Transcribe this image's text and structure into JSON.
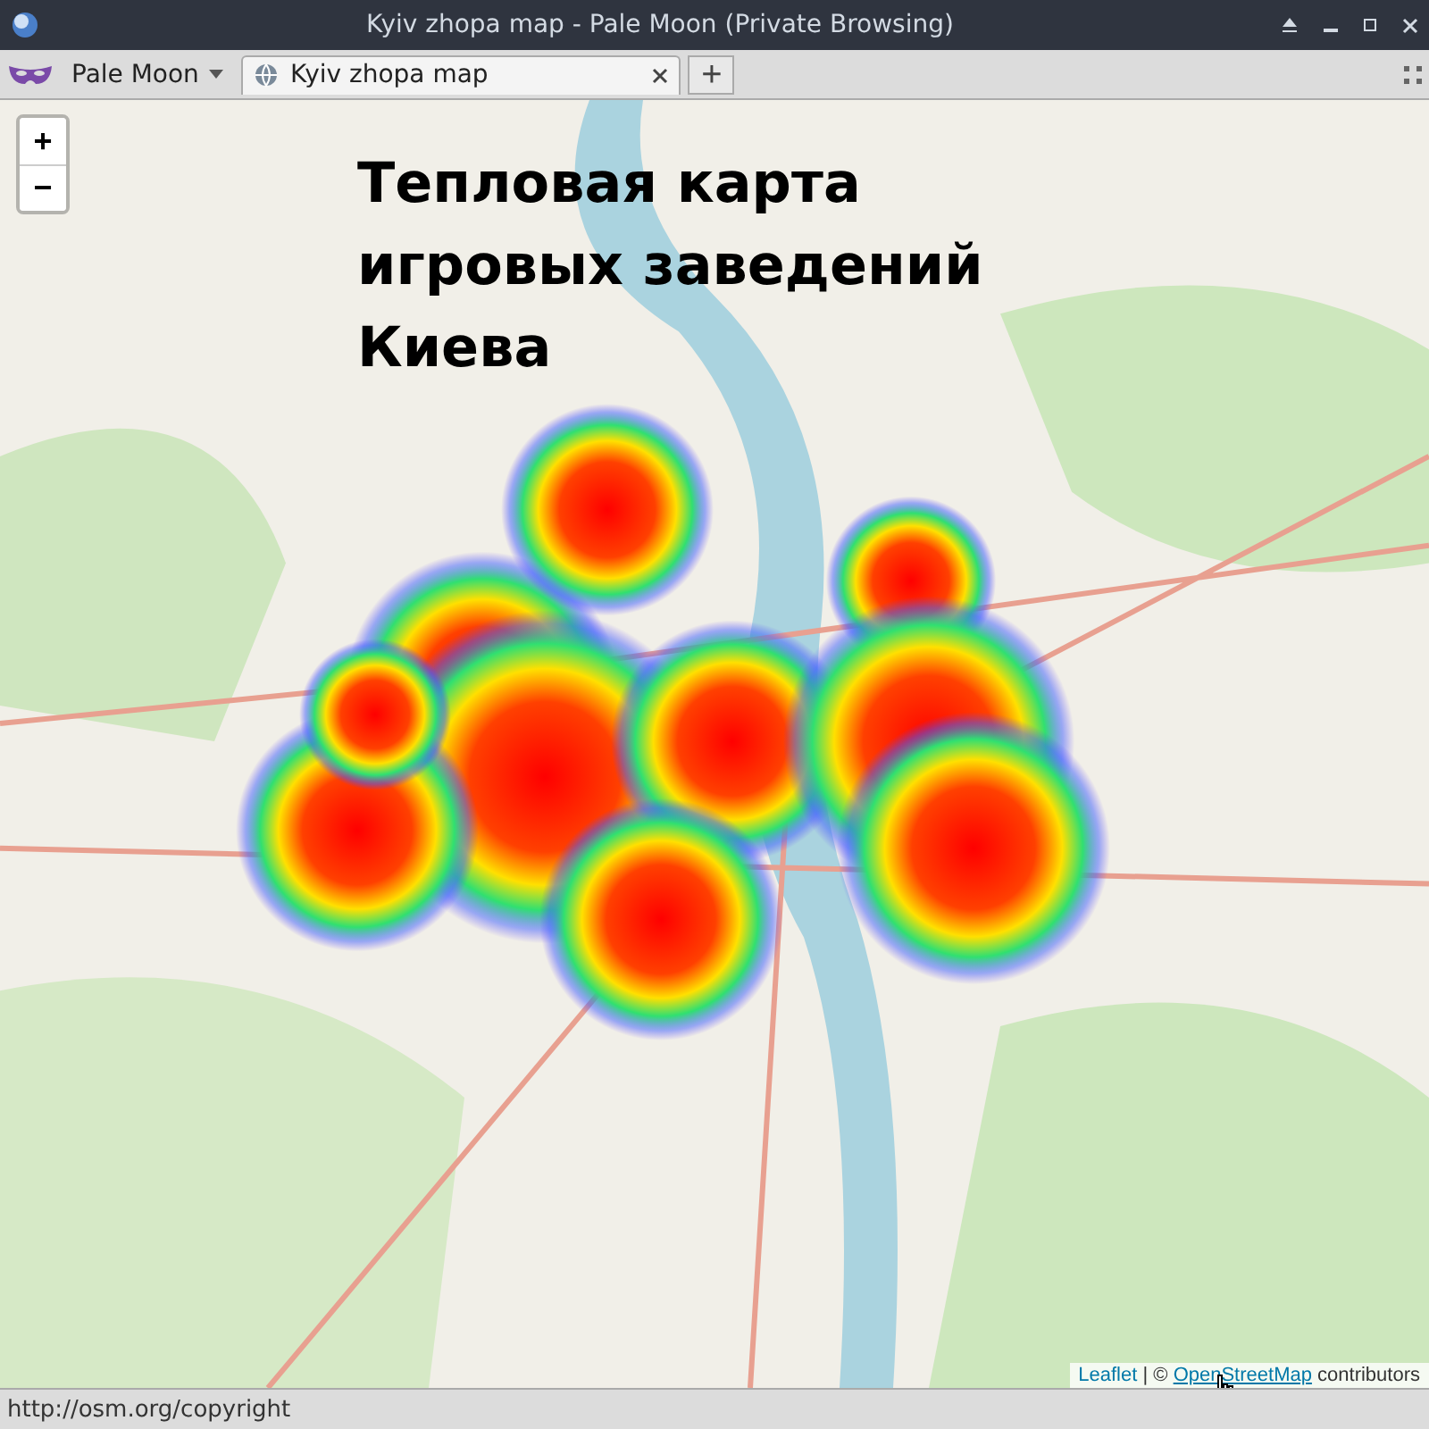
{
  "window": {
    "title": "Kyiv zhopa map - Pale Moon (Private Browsing)"
  },
  "toolbar": {
    "app_menu": "Pale Moon",
    "tabs": [
      {
        "label": "Kyiv zhopa map",
        "selected": true
      }
    ],
    "new_tab": "+"
  },
  "map": {
    "title": "Тепловая карта игровых заведений Киева",
    "zoom_in": "+",
    "zoom_out": "−",
    "attribution": [
      {
        "kind": "link",
        "text": "Leaflet"
      },
      {
        "kind": "text",
        "text": " | © "
      },
      {
        "kind": "link",
        "text": "OpenStreetMap"
      },
      {
        "kind": "text",
        "text": " contributors"
      }
    ]
  },
  "status_bar": {
    "text": "http://osm.org/copyright"
  }
}
